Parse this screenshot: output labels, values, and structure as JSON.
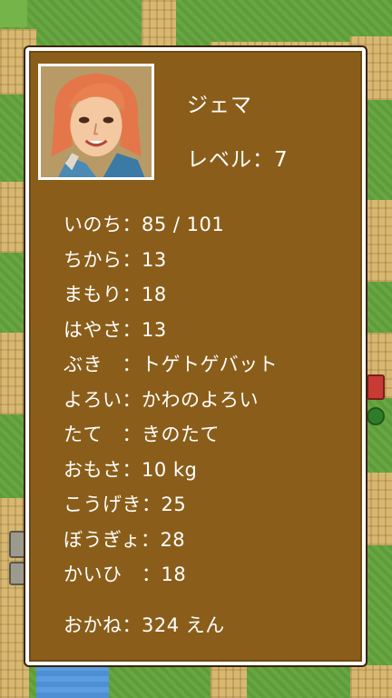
{
  "character": {
    "name": "ジェマ",
    "level": "レベル：7",
    "portrait_icon": "character-portrait"
  },
  "stats": [
    {
      "label": "いのち：85 / 101"
    },
    {
      "label": "ちから：13"
    },
    {
      "label": "まもり：18"
    },
    {
      "label": "はやさ：13"
    },
    {
      "label": "ぶき　：トゲトゲバット"
    },
    {
      "label": "よろい：かわのよろい"
    },
    {
      "label": "たて　：きのたて"
    },
    {
      "label": "おもさ：10 kg"
    },
    {
      "label": "こうげき：25"
    },
    {
      "label": "ぼうぎょ：28"
    },
    {
      "label": "かいひ　：18"
    }
  ],
  "gold": "おかね：324 えん",
  "colors": {
    "window_bg": "#8a5e1a",
    "window_border": "#ffffff",
    "text": "#ffffff",
    "grass": "#62a23c",
    "path": "#d8b870",
    "water": "#4e8fd4"
  }
}
